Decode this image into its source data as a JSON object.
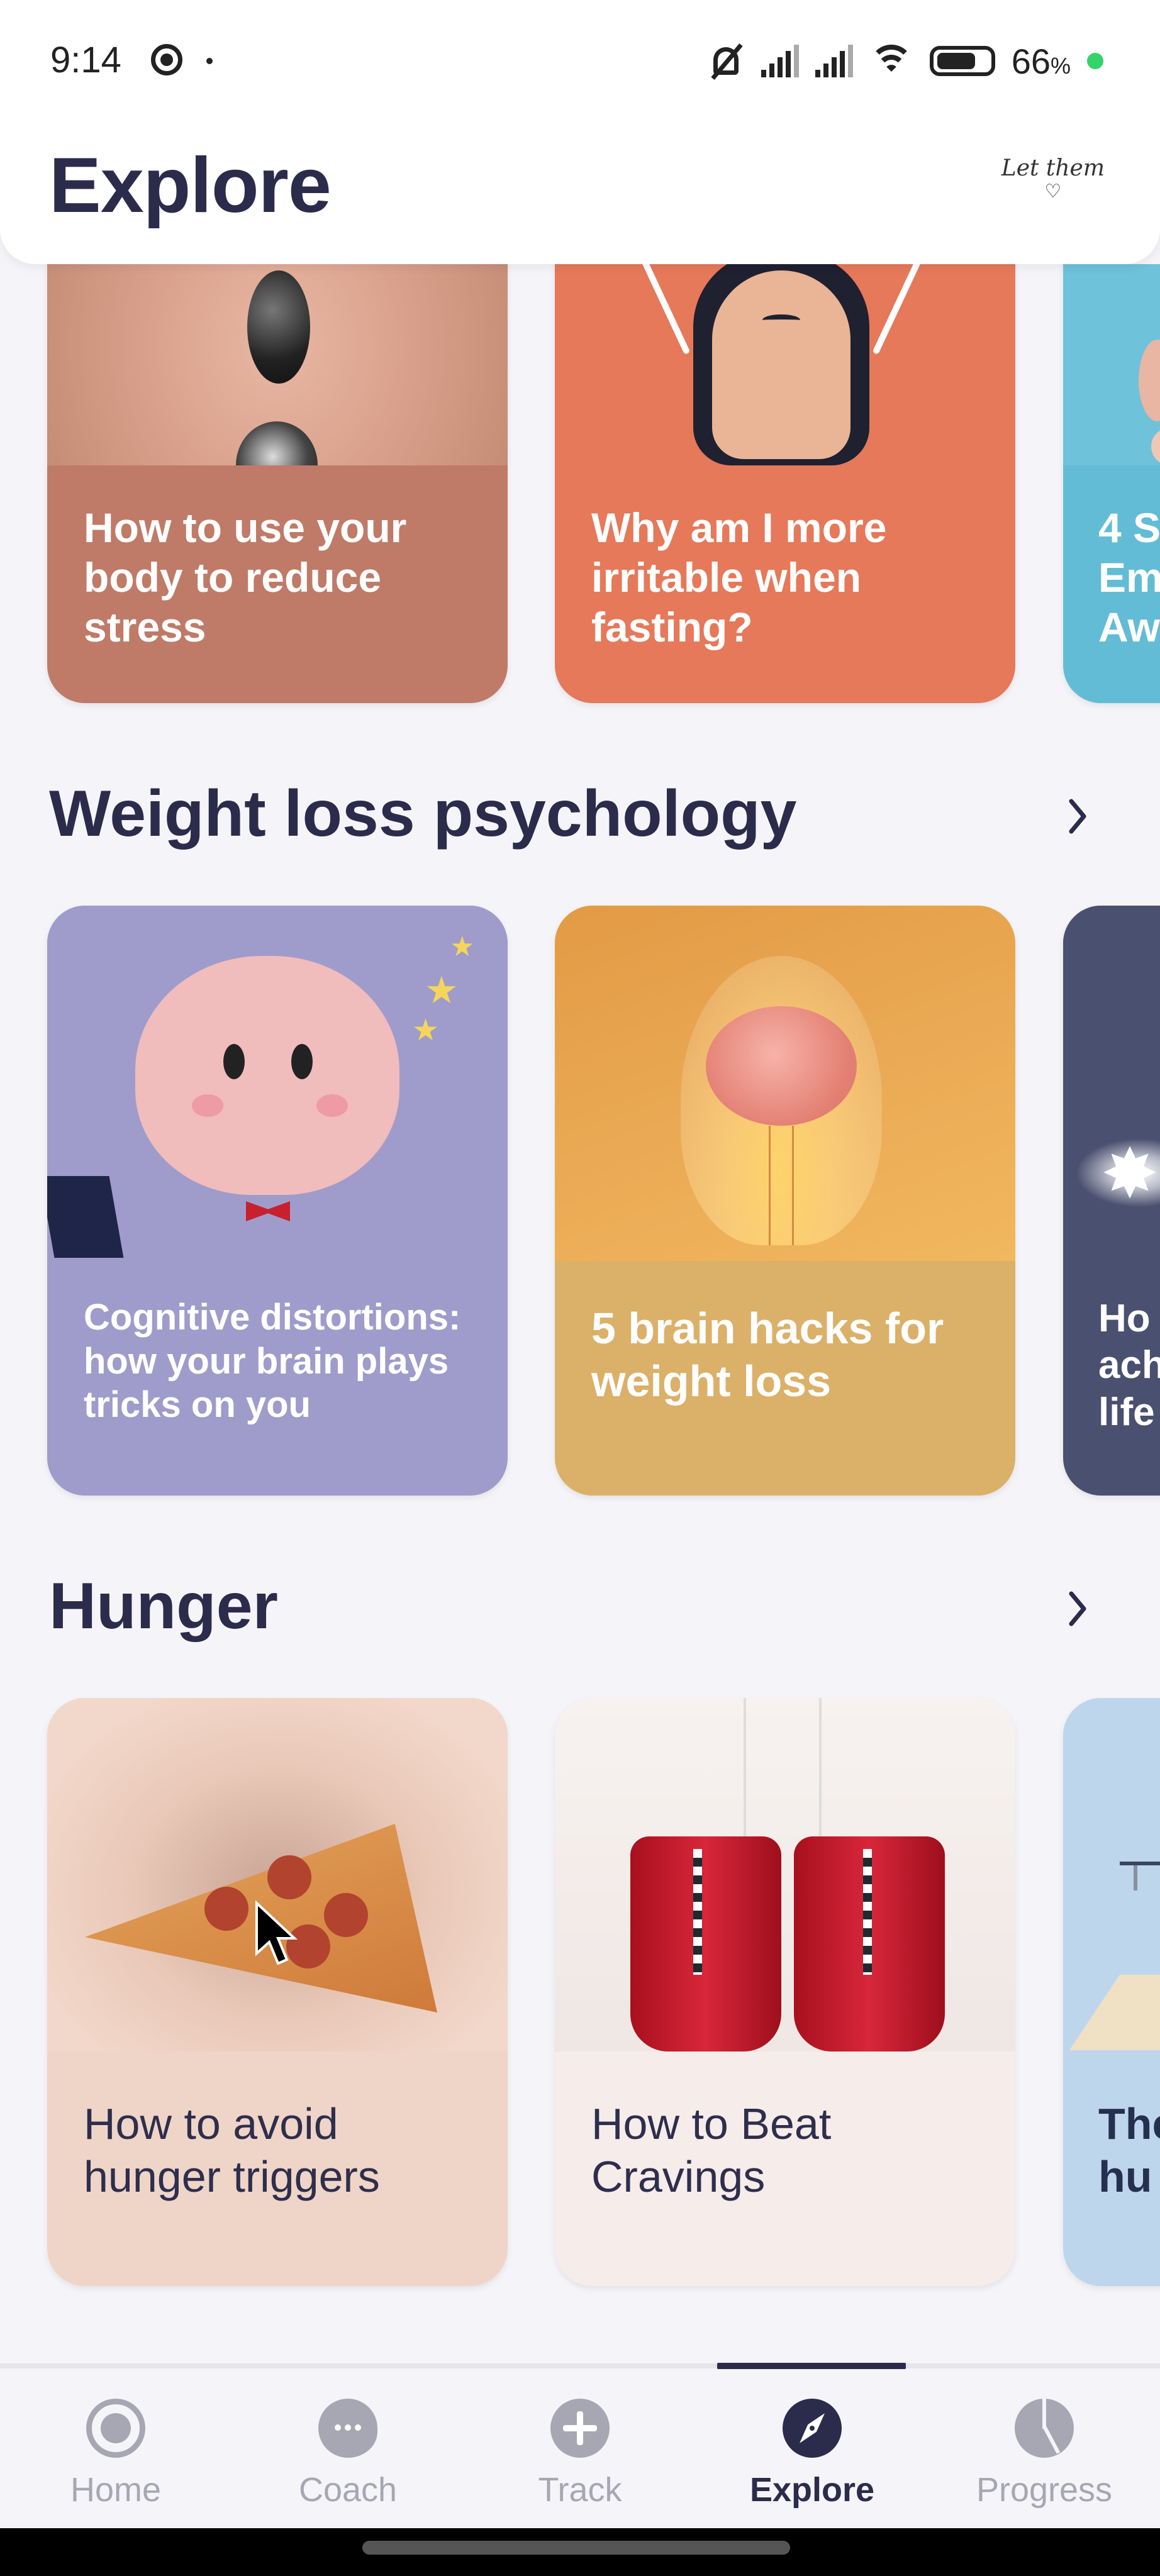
{
  "status_bar": {
    "time": "9:14",
    "battery_percent": "66",
    "battery_unit": "%",
    "icons": [
      "screen-record-icon",
      "mute-icon",
      "signal-icon",
      "signal-icon",
      "wifi-icon",
      "battery-icon",
      "charging-dot-icon"
    ]
  },
  "header": {
    "title": "Explore",
    "logo_text": "Let them",
    "logo_heart": "♡"
  },
  "sections": [
    {
      "title": "",
      "cards": [
        {
          "title": "How to use your body to reduce stress",
          "bg": "#bf7b68",
          "image": "hot-stones-back-photo",
          "text_color": "#ffffff"
        },
        {
          "title": "Why am I more irritable when fasting?",
          "bg": "#e5795a",
          "image": "grumpy-hedgehog-illustration",
          "text_color": "#ffffff"
        },
        {
          "title": "4 S… Em… Aw…",
          "bg": "#63bcd6",
          "image": "partial-image",
          "text_color": "#ffffff"
        }
      ]
    },
    {
      "title": "Weight loss psychology",
      "see_all_icon": "chevron-right-icon",
      "cards": [
        {
          "title": "Cognitive distortions: how your brain plays tricks on you",
          "bg": "#9f9ccb",
          "image": "magician-brain-illustration",
          "text_color": "#ffffff"
        },
        {
          "title": "5 brain hacks for weight loss",
          "bg": "#dbb069",
          "image": "brain-lightbulb-photo",
          "text_color": "#ffffff"
        },
        {
          "title": "Ho… ach… life…",
          "bg": "#4a5070",
          "image": "sparkle-illustration",
          "text_color": "#ffffff"
        }
      ]
    },
    {
      "title": "Hunger",
      "see_all_icon": "chevron-right-icon",
      "cards": [
        {
          "title": "How to avoid hunger triggers",
          "bg": "#efd5c8",
          "image": "pepperoni-pizza-slice-photo",
          "text_color": "#2e2e4d"
        },
        {
          "title": "How to Beat Cravings",
          "bg": "#f6ecea",
          "image": "boxing-gloves-photo",
          "text_color": "#2e2e4d"
        },
        {
          "title": "The… hu…",
          "bg": "#bed6ec",
          "image": "scale-illustration",
          "text_color": "#253050"
        }
      ]
    }
  ],
  "tabbar": {
    "active": "Explore",
    "tabs": [
      {
        "label": "Home",
        "icon": "home-ring-icon"
      },
      {
        "label": "Coach",
        "icon": "chat-bubble-icon"
      },
      {
        "label": "Track",
        "icon": "plus-circle-icon"
      },
      {
        "label": "Explore",
        "icon": "compass-icon"
      },
      {
        "label": "Progress",
        "icon": "pie-chart-icon"
      }
    ]
  },
  "colors": {
    "text_primary": "#2b2b4b",
    "inactive": "#a7a7b3",
    "background": "#f5f5f9",
    "charging": "#35d36a"
  }
}
